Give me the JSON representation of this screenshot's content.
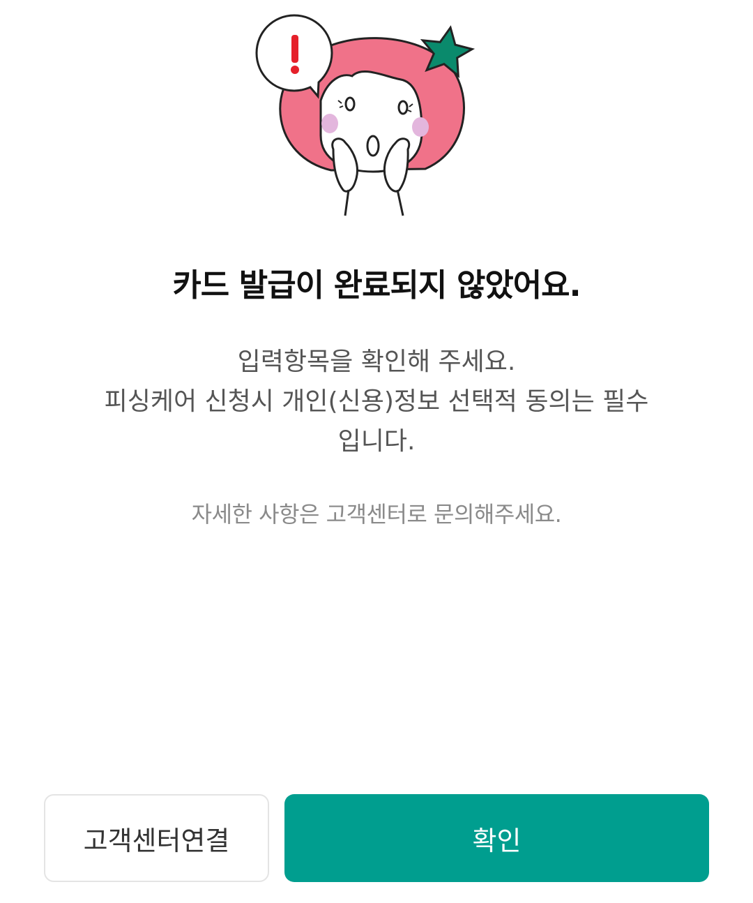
{
  "illustration": {
    "alert_icon": "exclamation-icon",
    "character": "surprised-girl-with-star-hairpin",
    "colors": {
      "hair": "#f07289",
      "star": "#0a8a6c",
      "alert": "#e5202a",
      "blush": "#e3b6dd"
    }
  },
  "dialog": {
    "title": "카드 발급이 완료되지 않았어요.",
    "message_lines": [
      "입력항목을 확인해 주세요.",
      "피싱케어 신청시 개인(신용)정보 선택적 동의는 필수",
      "입니다."
    ],
    "notice": "자세한 사항은 고객센터로 문의해주세요."
  },
  "buttons": {
    "secondary_label": "고객센터연결",
    "primary_label": "확인"
  },
  "colors": {
    "primary": "#009e8f",
    "title_text": "#111111",
    "body_text": "#555555",
    "muted_text": "#8a8a8a"
  }
}
